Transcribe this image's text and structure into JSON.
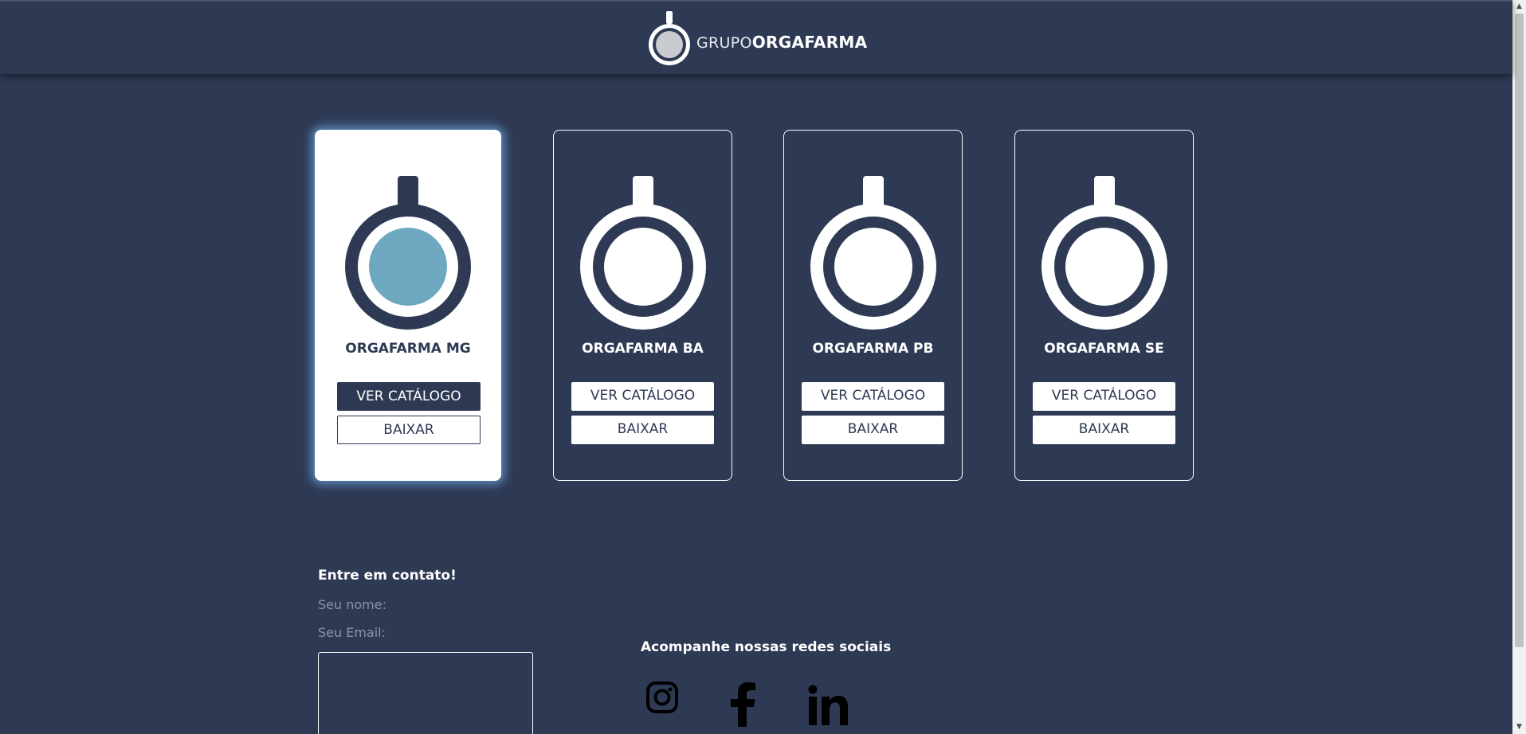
{
  "header": {
    "logo_thin": "GRUPO",
    "logo_bold": "ORGAFARMA"
  },
  "cards": [
    {
      "name": "ORGAFARMA MG",
      "view_label": "VER CATÁLOGO",
      "download_label": "BAIXAR",
      "active": true
    },
    {
      "name": "ORGAFARMA BA",
      "view_label": "VER CATÁLOGO",
      "download_label": "BAIXAR",
      "active": false
    },
    {
      "name": "ORGAFARMA PB",
      "view_label": "VER CATÁLOGO",
      "download_label": "BAIXAR",
      "active": false
    },
    {
      "name": "ORGAFARMA SE",
      "view_label": "VER CATÁLOGO",
      "download_label": "BAIXAR",
      "active": false
    }
  ],
  "contact": {
    "title": "Entre em contato!",
    "name_placeholder": "Seu nome:",
    "email_placeholder": "Seu Email:"
  },
  "social": {
    "title": "Acompanhe nossas redes sociais",
    "icons": [
      "instagram-icon",
      "facebook-icon",
      "linkedin-icon"
    ]
  },
  "colors": {
    "background": "#2e3a54",
    "accent_blue": "#6da8c0",
    "white": "#ffffff"
  }
}
